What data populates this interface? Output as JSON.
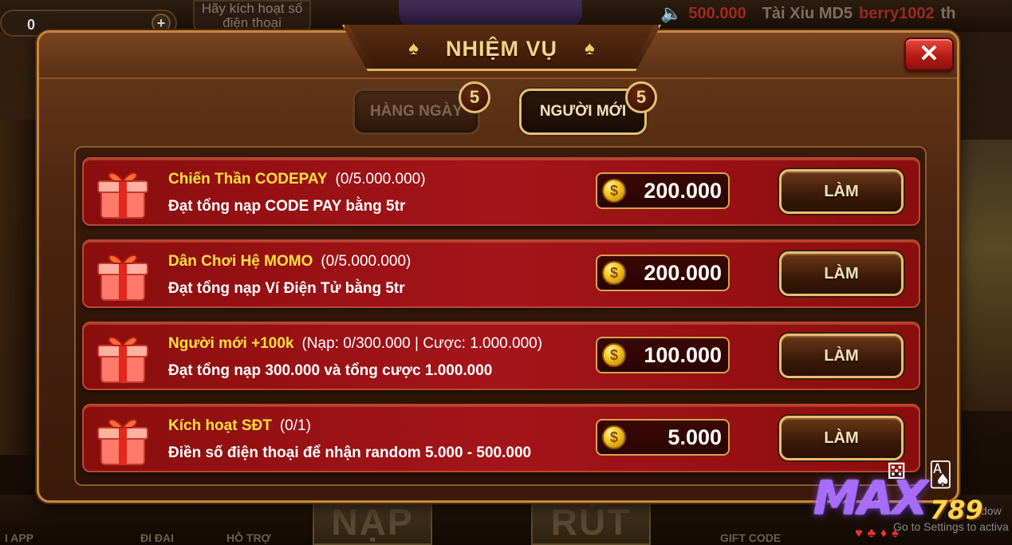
{
  "background": {
    "coin_value": "0",
    "plus": "+",
    "activate_text": "Hãy kích hoạt số điện thoại",
    "ticker": {
      "amount": "500.000",
      "game": "Tài Xỉu MD5",
      "user": "berry1002",
      "tail": "th"
    },
    "bottom_labels": [
      "I APP",
      "ĐI ĐAI",
      "HỖ TRỢ",
      "GIFT CODE"
    ],
    "big_buttons": [
      "NẠP",
      "RÚT"
    ],
    "windows_notice": "Go to Settings to activa",
    "windows_notice_top": "dow"
  },
  "modal": {
    "title": "NHIỆM VỤ",
    "close_icon": "close-icon",
    "tabs": [
      {
        "label": "HÀNG NGÀY",
        "badge": "5",
        "active": false
      },
      {
        "label": "NGƯỜI MỚI",
        "badge": "5",
        "active": true
      }
    ],
    "missions": [
      {
        "name": "Chiến Thần CODEPAY",
        "progress": "(0/5.000.000)",
        "description": "Đạt tổng nạp CODE PAY bằng 5tr",
        "reward": "200.000",
        "button": "LÀM"
      },
      {
        "name": "Dân Chơi Hệ MOMO",
        "progress": "(0/5.000.000)",
        "description": "Đạt tổng nạp Ví Điện Tử bằng 5tr",
        "reward": "200.000",
        "button": "LÀM"
      },
      {
        "name": "Người mới +100k",
        "progress": "(Nạp: 0/300.000 | Cược: 1.000.000)",
        "description": "Đạt tổng nạp 300.000 và tổng cược 1.000.000",
        "reward": "100.000",
        "button": "LÀM"
      },
      {
        "name": "Kích hoạt SĐT",
        "progress": "(0/1)",
        "description": "Điền số điện thoại để nhận random 5.000 - 500.000",
        "reward": "5.000",
        "button": "LÀM"
      }
    ]
  },
  "brand": {
    "name": "MAX",
    "number": "789"
  },
  "colors": {
    "title_gold": "#f3d48a",
    "mission_name_yellow": "#ffe03a",
    "row_red": "#a5141a",
    "close_red": "#e8483c"
  }
}
